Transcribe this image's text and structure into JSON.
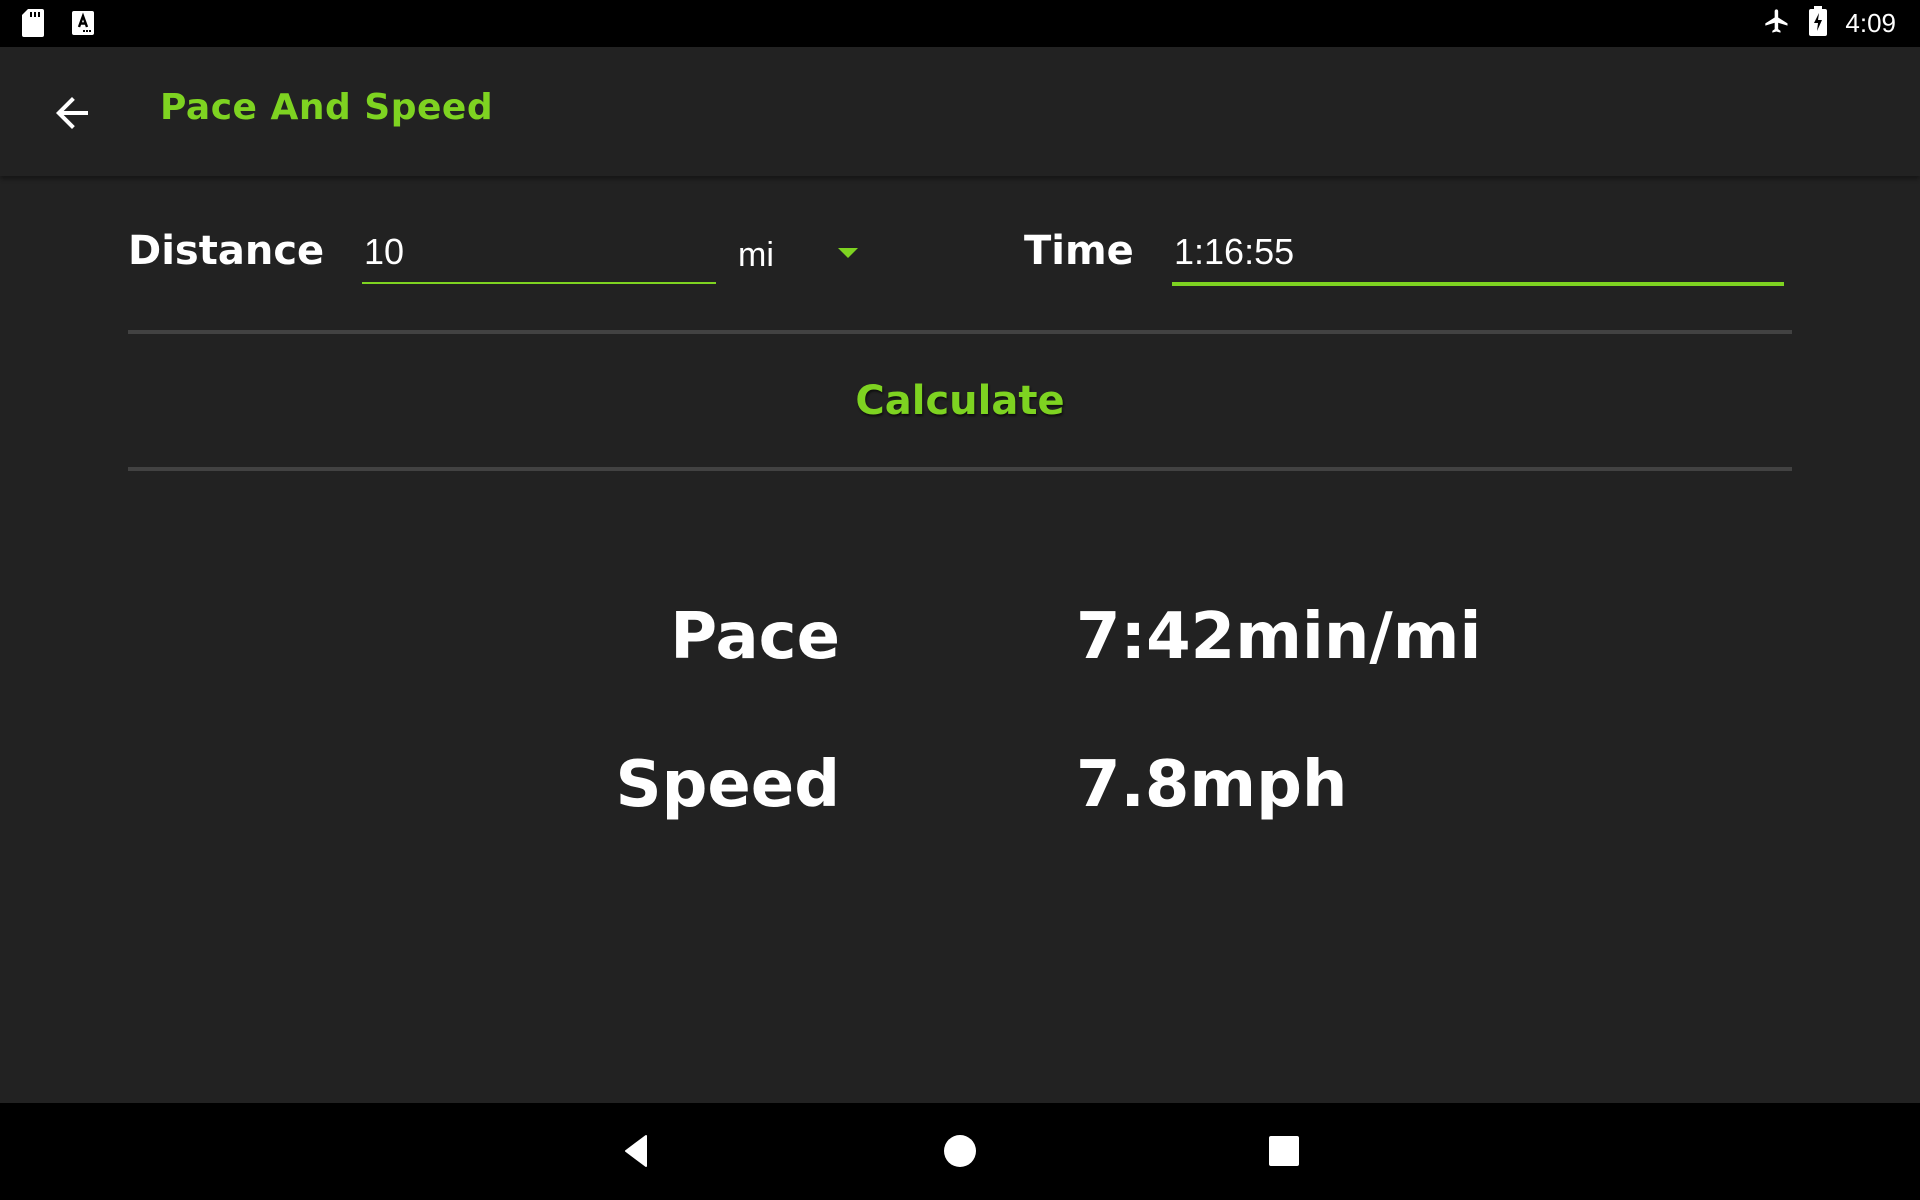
{
  "status_bar": {
    "left_icons": [
      "sd-card-icon",
      "autofill-keyboard-icon"
    ],
    "right_icons": [
      "airplane-mode-icon",
      "battery-charging-icon"
    ],
    "time": "4:09"
  },
  "app_bar": {
    "back_icon": "arrow-back-icon",
    "title": "Pace And Speed"
  },
  "form": {
    "distance": {
      "label": "Distance",
      "value": "10",
      "unit": "mi"
    },
    "time": {
      "label": "Time",
      "value": "1:16:55"
    },
    "calculate_label": "Calculate"
  },
  "results": {
    "pace": {
      "label": "Pace",
      "value": "7:42min/mi"
    },
    "speed": {
      "label": "Speed",
      "value": "7.8mph"
    }
  },
  "nav_bar": {
    "buttons": [
      "nav-back-icon",
      "nav-home-icon",
      "nav-recents-icon"
    ]
  },
  "colors": {
    "accent": "#7ed321",
    "background": "#222222",
    "divider": "#424242",
    "system_bars": "#000000"
  }
}
